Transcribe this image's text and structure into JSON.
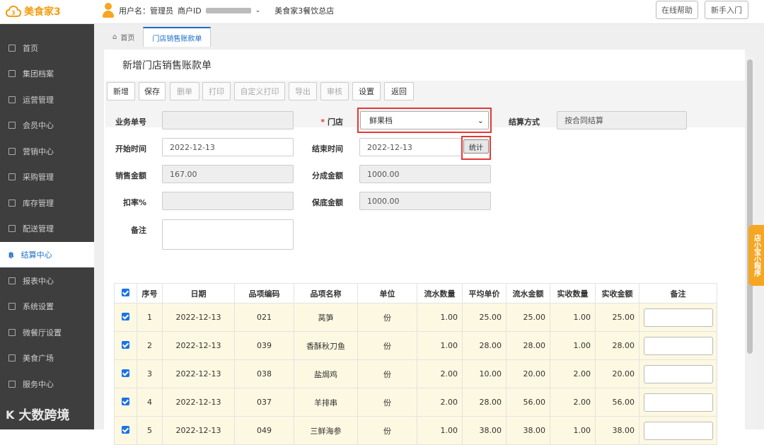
{
  "app": {
    "title": "美食家3"
  },
  "user": {
    "name_label": "用户名：管理员",
    "merchant_label": "商户ID",
    "store": "美食家3餐饮总店"
  },
  "top_buttons": [
    "在线帮助",
    "新手入门"
  ],
  "sidebar": {
    "items": [
      {
        "label": "首页",
        "icon": "home-icon"
      },
      {
        "label": "集团档案",
        "icon": "file-icon"
      },
      {
        "label": "运营管理",
        "icon": "chart-icon"
      },
      {
        "label": "会员中心",
        "icon": "card-icon"
      },
      {
        "label": "营销中心",
        "icon": "edit-icon"
      },
      {
        "label": "采购管理",
        "icon": "cart-icon"
      },
      {
        "label": "库存管理",
        "icon": "box-icon"
      },
      {
        "label": "配送管理",
        "icon": "truck-icon"
      },
      {
        "label": "结算中心",
        "icon": "bitcoin-icon",
        "active": true
      },
      {
        "label": "报表中心",
        "icon": "report-icon"
      },
      {
        "label": "系统设置",
        "icon": "gear-icon"
      },
      {
        "label": "微餐厅设置",
        "icon": "fork-icon"
      },
      {
        "label": "美食广场",
        "icon": "plaza-icon"
      },
      {
        "label": "服务中心",
        "icon": "service-icon"
      }
    ]
  },
  "watermark": "大数跨境",
  "tabs": [
    {
      "label": "首页"
    },
    {
      "label": "门店销售账款单",
      "active": true
    }
  ],
  "page_title": "新增门店销售账款单",
  "toolbar": [
    {
      "label": "新增",
      "disabled": false
    },
    {
      "label": "保存",
      "disabled": false
    },
    {
      "label": "删单",
      "disabled": true
    },
    {
      "label": "打印",
      "disabled": true
    },
    {
      "label": "自定义打印",
      "disabled": true
    },
    {
      "label": "导出",
      "disabled": true
    },
    {
      "label": "审核",
      "disabled": true
    },
    {
      "label": "设置",
      "disabled": false
    },
    {
      "label": "返回",
      "disabled": false
    }
  ],
  "form": {
    "biz_no": {
      "label": "业务单号",
      "value": ""
    },
    "store": {
      "label": "门店",
      "value": "鲜果档"
    },
    "settle": {
      "label": "结算方式",
      "value": "按合同结算"
    },
    "start": {
      "label": "开始时间",
      "value": "2022-12-13"
    },
    "end": {
      "label": "结束时间",
      "value": "2022-12-13"
    },
    "stat_button": "统计",
    "sales": {
      "label": "销售金额",
      "value": "167.00"
    },
    "share": {
      "label": "分成金额",
      "value": "1000.00"
    },
    "discount": {
      "label": "扣率%",
      "value": ""
    },
    "guarantee": {
      "label": "保底金额",
      "value": "1000.00"
    },
    "remark": {
      "label": "备注",
      "value": ""
    }
  },
  "table": {
    "headers": [
      "序号",
      "日期",
      "品项编码",
      "品项名称",
      "单位",
      "流水数量",
      "平均单价",
      "流水金额",
      "实收数量",
      "实收金额",
      "备注"
    ],
    "rows": [
      [
        "1",
        "2022-12-13",
        "021",
        "莴笋",
        "份",
        "1.00",
        "25.00",
        "25.00",
        "1.00",
        "25.00"
      ],
      [
        "2",
        "2022-12-13",
        "039",
        "香酥秋刀鱼",
        "份",
        "1.00",
        "28.00",
        "28.00",
        "1.00",
        "28.00"
      ],
      [
        "3",
        "2022-12-13",
        "038",
        "盐焗鸡",
        "份",
        "2.00",
        "10.00",
        "20.00",
        "2.00",
        "20.00"
      ],
      [
        "4",
        "2022-12-13",
        "037",
        "羊排串",
        "份",
        "2.00",
        "28.00",
        "56.00",
        "2.00",
        "56.00"
      ],
      [
        "5",
        "2022-12-13",
        "049",
        "三鲜海参",
        "份",
        "1.00",
        "38.00",
        "38.00",
        "1.00",
        "38.00"
      ]
    ]
  },
  "mini_program": "店小宝小程序",
  "colors": {
    "accent": "#1a6ec7",
    "brand": "#f39c12",
    "highlight": "#e53935",
    "row_bg": "#fdf8e1"
  }
}
